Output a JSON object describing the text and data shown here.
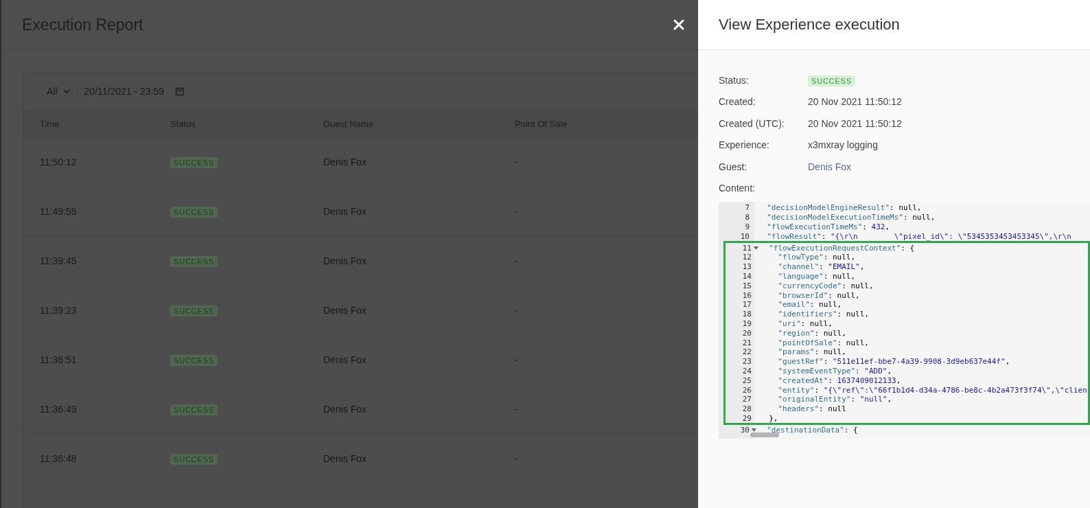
{
  "report": {
    "title": "Execution Report",
    "filters": {
      "type": "All",
      "date_range": "20/11/2021 - 23:59"
    },
    "table": {
      "columns": [
        "Time",
        "Status",
        "Guest Name",
        "Point Of Sale"
      ],
      "rows": [
        {
          "time": "11:50:12",
          "status": "SUCCESS",
          "guest": "Denis Fox",
          "point_of_sale": "-"
        },
        {
          "time": "11:49:55",
          "status": "SUCCESS",
          "guest": "Denis Fox",
          "point_of_sale": "-"
        },
        {
          "time": "11:39:45",
          "status": "SUCCESS",
          "guest": "Denis Fox",
          "point_of_sale": "-"
        },
        {
          "time": "11:39:23",
          "status": "SUCCESS",
          "guest": "Denis Fox",
          "point_of_sale": "-"
        },
        {
          "time": "11:36:51",
          "status": "SUCCESS",
          "guest": "Denis Fox",
          "point_of_sale": "-"
        },
        {
          "time": "11:36:49",
          "status": "SUCCESS",
          "guest": "Denis Fox",
          "point_of_sale": "-"
        },
        {
          "time": "11:36:48",
          "status": "SUCCESS",
          "guest": "Denis Fox",
          "point_of_sale": "-"
        }
      ]
    }
  },
  "panel": {
    "title": "View Experience execution",
    "details": [
      {
        "label": "Status:",
        "value": "SUCCESS",
        "kind": "badge"
      },
      {
        "label": "Created:",
        "value": "20 Nov 2021 11:50:12",
        "kind": "text"
      },
      {
        "label": "Created (UTC):",
        "value": "20 Nov 2021 11:50:12",
        "kind": "text"
      },
      {
        "label": "Experience:",
        "value": "x3mxray logging",
        "kind": "text"
      },
      {
        "label": "Guest:",
        "value": "Denis Fox",
        "kind": "link"
      }
    ],
    "content_label": "Content:",
    "content_blocks": [
      {
        "lines": [
          {
            "number": "7",
            "foldable": false,
            "tokens": [
              {
                "text": "\"decisionModelEngineResult\"",
                "kind": "key"
              },
              {
                "text": ":",
                "kind": "colon"
              },
              {
                "text": "null",
                "kind": "null"
              },
              {
                "text": ",",
                "kind": "punct"
              }
            ]
          },
          {
            "number": "8",
            "foldable": false,
            "tokens": [
              {
                "text": "\"decisionModelExecutionTimeMs\"",
                "kind": "key"
              },
              {
                "text": ":",
                "kind": "colon"
              },
              {
                "text": "null",
                "kind": "null"
              },
              {
                "text": ",",
                "kind": "punct"
              }
            ]
          },
          {
            "number": "9",
            "foldable": false,
            "tokens": [
              {
                "text": "\"flowExecutionTimeMs\"",
                "kind": "key"
              },
              {
                "text": ":",
                "kind": "colon"
              },
              {
                "text": "432",
                "kind": "number"
              },
              {
                "text": ",",
                "kind": "punct"
              }
            ]
          },
          {
            "number": "10",
            "foldable": false,
            "tokens": [
              {
                "text": "\"flowResult\"",
                "kind": "key"
              },
              {
                "text": ":",
                "kind": "colon"
              },
              {
                "text": "\"{\\r\\n        \\\"pixel_id\\\": \\\"5345353453453345\\\",\\r\\n",
                "kind": "string"
              }
            ]
          }
        ]
      },
      {
        "highlighted": true,
        "lines": [
          {
            "number": "11",
            "foldable": true,
            "tokens": [
              {
                "text": "\"flowExecutionRequestContext\"",
                "kind": "key"
              },
              {
                "text": ":",
                "kind": "colon"
              },
              {
                "text": "{",
                "kind": "punct"
              }
            ],
            "children": [
              {
                "number": "12",
                "foldable": false,
                "tokens": [
                  {
                    "text": "\"flowType\"",
                    "kind": "key"
                  },
                  {
                    "text": ":",
                    "kind": "colon"
                  },
                  {
                    "text": "null",
                    "kind": "null"
                  },
                  {
                    "text": ",",
                    "kind": "punct"
                  }
                ]
              },
              {
                "number": "13",
                "foldable": false,
                "tokens": [
                  {
                    "text": "\"channel\"",
                    "kind": "key"
                  },
                  {
                    "text": ":",
                    "kind": "colon"
                  },
                  {
                    "text": "\"EMAIL\"",
                    "kind": "string"
                  },
                  {
                    "text": ",",
                    "kind": "punct"
                  }
                ]
              },
              {
                "number": "14",
                "foldable": false,
                "tokens": [
                  {
                    "text": "\"language\"",
                    "kind": "key"
                  },
                  {
                    "text": ":",
                    "kind": "colon"
                  },
                  {
                    "text": "null",
                    "kind": "null"
                  },
                  {
                    "text": ",",
                    "kind": "punct"
                  }
                ]
              },
              {
                "number": "15",
                "foldable": false,
                "tokens": [
                  {
                    "text": "\"currencyCode\"",
                    "kind": "key"
                  },
                  {
                    "text": ":",
                    "kind": "colon"
                  },
                  {
                    "text": "null",
                    "kind": "null"
                  },
                  {
                    "text": ",",
                    "kind": "punct"
                  }
                ]
              },
              {
                "number": "16",
                "foldable": false,
                "tokens": [
                  {
                    "text": "\"browserId\"",
                    "kind": "key"
                  },
                  {
                    "text": ":",
                    "kind": "colon"
                  },
                  {
                    "text": "null",
                    "kind": "null"
                  },
                  {
                    "text": ",",
                    "kind": "punct"
                  }
                ]
              },
              {
                "number": "17",
                "foldable": false,
                "tokens": [
                  {
                    "text": "\"email\"",
                    "kind": "key"
                  },
                  {
                    "text": ":",
                    "kind": "colon"
                  },
                  {
                    "text": "null",
                    "kind": "null"
                  },
                  {
                    "text": ",",
                    "kind": "punct"
                  }
                ]
              },
              {
                "number": "18",
                "foldable": false,
                "tokens": [
                  {
                    "text": "\"identifiers\"",
                    "kind": "key"
                  },
                  {
                    "text": ":",
                    "kind": "colon"
                  },
                  {
                    "text": "null",
                    "kind": "null"
                  },
                  {
                    "text": ",",
                    "kind": "punct"
                  }
                ]
              },
              {
                "number": "19",
                "foldable": false,
                "tokens": [
                  {
                    "text": "\"uri\"",
                    "kind": "key"
                  },
                  {
                    "text": ":",
                    "kind": "colon"
                  },
                  {
                    "text": "null",
                    "kind": "null"
                  },
                  {
                    "text": ",",
                    "kind": "punct"
                  }
                ]
              },
              {
                "number": "20",
                "foldable": false,
                "tokens": [
                  {
                    "text": "\"region\"",
                    "kind": "key"
                  },
                  {
                    "text": ":",
                    "kind": "colon"
                  },
                  {
                    "text": "null",
                    "kind": "null"
                  },
                  {
                    "text": ",",
                    "kind": "punct"
                  }
                ]
              },
              {
                "number": "21",
                "foldable": false,
                "tokens": [
                  {
                    "text": "\"pointOfSale\"",
                    "kind": "key"
                  },
                  {
                    "text": ":",
                    "kind": "colon"
                  },
                  {
                    "text": "null",
                    "kind": "null"
                  },
                  {
                    "text": ",",
                    "kind": "punct"
                  }
                ]
              },
              {
                "number": "22",
                "foldable": false,
                "tokens": [
                  {
                    "text": "\"params\"",
                    "kind": "key"
                  },
                  {
                    "text": ":",
                    "kind": "colon"
                  },
                  {
                    "text": "null",
                    "kind": "null"
                  },
                  {
                    "text": ",",
                    "kind": "punct"
                  }
                ]
              },
              {
                "number": "23",
                "foldable": false,
                "tokens": [
                  {
                    "text": "\"guestRef\"",
                    "kind": "key"
                  },
                  {
                    "text": ":",
                    "kind": "colon"
                  },
                  {
                    "text": "\"511e11ef-bbe7-4a39-9908-3d9eb637e44f\"",
                    "kind": "string"
                  },
                  {
                    "text": ",",
                    "kind": "punct"
                  }
                ]
              },
              {
                "number": "24",
                "foldable": false,
                "tokens": [
                  {
                    "text": "\"systemEventType\"",
                    "kind": "key"
                  },
                  {
                    "text": ":",
                    "kind": "colon"
                  },
                  {
                    "text": "\"ADD\"",
                    "kind": "string"
                  },
                  {
                    "text": ",",
                    "kind": "punct"
                  }
                ]
              },
              {
                "number": "25",
                "foldable": false,
                "tokens": [
                  {
                    "text": "\"createdAt\"",
                    "kind": "key"
                  },
                  {
                    "text": ":",
                    "kind": "colon"
                  },
                  {
                    "text": "1637409012133",
                    "kind": "number"
                  },
                  {
                    "text": ",",
                    "kind": "punct"
                  }
                ]
              },
              {
                "number": "26",
                "foldable": false,
                "tokens": [
                  {
                    "text": "\"entity\"",
                    "kind": "key"
                  },
                  {
                    "text": ":",
                    "kind": "colon"
                  },
                  {
                    "text": "\"{\\\"ref\\\":\\\"66f1b1d4-d34a-4786-be8c-4b2a473f3f74\\\",\\\"clien",
                    "kind": "string"
                  }
                ]
              },
              {
                "number": "27",
                "foldable": false,
                "tokens": [
                  {
                    "text": "\"originalEntity\"",
                    "kind": "key"
                  },
                  {
                    "text": ":",
                    "kind": "colon"
                  },
                  {
                    "text": "\"null\"",
                    "kind": "string"
                  },
                  {
                    "text": ",",
                    "kind": "punct"
                  }
                ]
              },
              {
                "number": "28",
                "foldable": false,
                "tokens": [
                  {
                    "text": "\"headers\"",
                    "kind": "key"
                  },
                  {
                    "text": ":",
                    "kind": "colon"
                  },
                  {
                    "text": "null",
                    "kind": "null"
                  }
                ]
              }
            ]
          },
          {
            "number": "29",
            "foldable": false,
            "tokens": [
              {
                "text": "},",
                "kind": "punct"
              }
            ]
          }
        ]
      },
      {
        "lines": [
          {
            "number": "30",
            "foldable": true,
            "tokens": [
              {
                "text": "\"destinationData\"",
                "kind": "key"
              },
              {
                "text": ":",
                "kind": "colon"
              },
              {
                "text": "{",
                "kind": "punct"
              }
            ]
          }
        ]
      }
    ]
  }
}
